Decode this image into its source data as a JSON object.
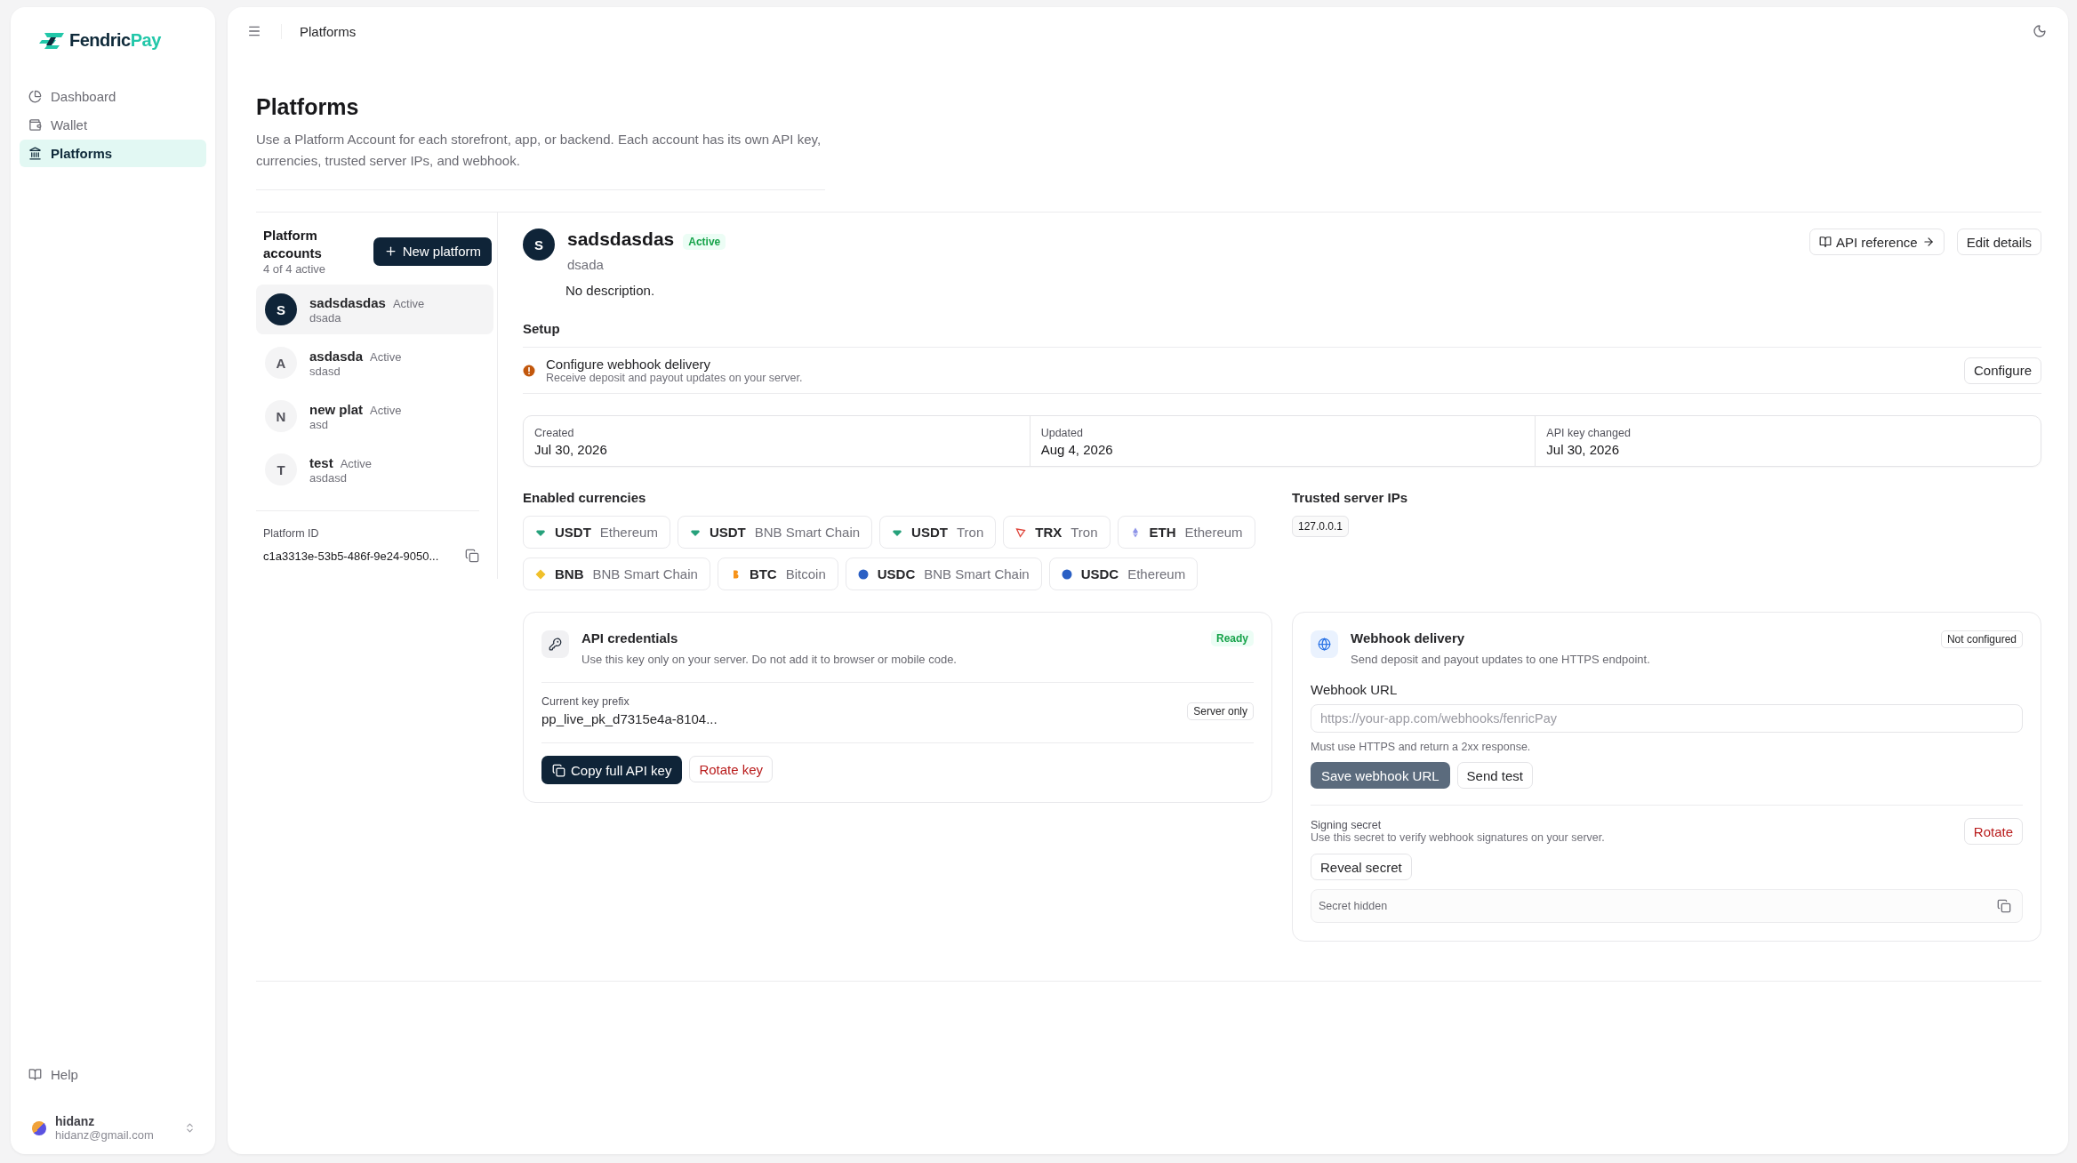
{
  "logo": {
    "prefix": "Fendric",
    "suffix": "Pay"
  },
  "nav": [
    {
      "label": "Dashboard",
      "selected": false
    },
    {
      "label": "Wallet",
      "selected": false
    },
    {
      "label": "Platforms",
      "selected": true
    }
  ],
  "help": "Help",
  "user": {
    "name": "hidanz",
    "email": "hidanz@gmail.com"
  },
  "topbar": {
    "title": "Platforms"
  },
  "page": {
    "title": "Platforms",
    "description": "Use a Platform Account for each storefront, app, or backend. Each account has its own API key, currencies, trusted server IPs, and webhook."
  },
  "accounts": {
    "title": "Platform accounts",
    "count": "4 of 4 active",
    "new_button": "New platform",
    "items": [
      {
        "initial": "S",
        "name": "sadsdasdas",
        "status": "Active",
        "slug": "dsada",
        "selected": true
      },
      {
        "initial": "A",
        "name": "asdasda",
        "status": "Active",
        "slug": "sdasd",
        "selected": false
      },
      {
        "initial": "N",
        "name": "new plat",
        "status": "Active",
        "slug": "asd",
        "selected": false
      },
      {
        "initial": "T",
        "name": "test",
        "status": "Active",
        "slug": "asdasd",
        "selected": false
      }
    ],
    "id_label": "Platform ID",
    "id_value": "c1a3313e-53b5-486f-9e24-9050..."
  },
  "detail": {
    "initial": "S",
    "name": "sadsdasdas",
    "status": "Active",
    "slug": "dsada",
    "description": "No description.",
    "api_ref_button": "API reference",
    "edit_button": "Edit details",
    "setup_title": "Setup",
    "setup_items": [
      {
        "title": "Configure webhook delivery",
        "subtitle": "Receive deposit and payout updates on your server.",
        "action": "Configure"
      }
    ],
    "dates": [
      {
        "label": "Created",
        "value": "Jul 30, 2026"
      },
      {
        "label": "Updated",
        "value": "Aug 4, 2026"
      },
      {
        "label": "API key changed",
        "value": "Jul 30, 2026"
      }
    ],
    "currencies_title": "Enabled currencies",
    "currencies": [
      {
        "symbol": "USDT",
        "network": "Ethereum",
        "kind": "gem",
        "color": "#26a17b"
      },
      {
        "symbol": "USDT",
        "network": "BNB Smart Chain",
        "kind": "gem",
        "color": "#26a17b"
      },
      {
        "symbol": "USDT",
        "network": "Tron",
        "kind": "gem",
        "color": "#26a17b"
      },
      {
        "symbol": "TRX",
        "network": "Tron",
        "kind": "tron",
        "color": "#e0483e"
      },
      {
        "symbol": "ETH",
        "network": "Ethereum",
        "kind": "eth",
        "color": "#8f95e8"
      },
      {
        "symbol": "BNB",
        "network": "BNB Smart Chain",
        "kind": "bnb",
        "color": "#f0c02a"
      },
      {
        "symbol": "BTC",
        "network": "Bitcoin",
        "kind": "btc",
        "color": "#f7931a"
      },
      {
        "symbol": "USDC",
        "network": "BNB Smart Chain",
        "kind": "usdc",
        "color": "#2a5fc4"
      },
      {
        "symbol": "USDC",
        "network": "Ethereum",
        "kind": "usdc",
        "color": "#2a5fc4"
      }
    ],
    "ips_title": "Trusted server IPs",
    "ips": [
      "127.0.0.1"
    ],
    "api_card": {
      "title": "API credentials",
      "subtitle": "Use this key only on your server. Do not add it to browser or mobile code.",
      "badge": "Ready",
      "prefix_label": "Current key prefix",
      "prefix": "pp_live_pk_d7315e4a-8104...",
      "prefix_badge": "Server only",
      "copy_button": "Copy full API key",
      "rotate_button": "Rotate key"
    },
    "webhook_card": {
      "title": "Webhook delivery",
      "subtitle": "Send deposit and payout updates to one HTTPS endpoint.",
      "badge": "Not configured",
      "url_label": "Webhook URL",
      "url_placeholder": "https://your-app.com/webhooks/fenricPay",
      "hint": "Must use HTTPS and return a 2xx response.",
      "save_button": {
        "label": "Save webhook URL",
        "disabled": true
      },
      "test_button": "Send test",
      "secret_title": "Signing secret",
      "secret_subtitle": "Use this secret to verify webhook signatures on your server.",
      "rotate_button": "Rotate",
      "reveal_button": "Reveal secret",
      "secret_placeholder": "Secret hidden"
    }
  }
}
